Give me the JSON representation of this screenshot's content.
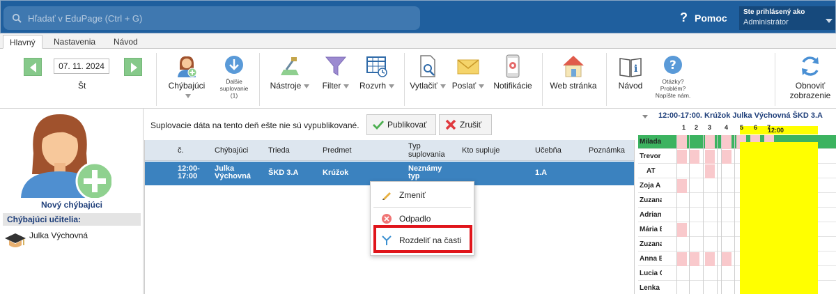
{
  "topbar": {
    "search_placeholder": "Hľadať v EduPage (Ctrl + G)",
    "help_label": "Pomoc",
    "user_line1": "Ste prihlásený ako",
    "user_line2": "Administrátor"
  },
  "tabs": [
    {
      "label": "Hlavný",
      "active": true
    },
    {
      "label": "Nastavenia",
      "active": false
    },
    {
      "label": "Návod",
      "active": false
    }
  ],
  "ribbon": {
    "date": "07. 11. 2024",
    "day": "Št",
    "chybajuci": "Chýbajúci",
    "dalsie_l1": "Ďalšie",
    "dalsie_l2": "suplovanie",
    "dalsie_l3": "(1)",
    "nastroje": "Nástroje",
    "filter": "Filter",
    "rozvrh": "Rozvrh",
    "vytlacit": "Vytlačiť",
    "poslat": "Poslať",
    "notifikacie": "Notifikácie",
    "web": "Web stránka",
    "navod": "Návod",
    "otazky_l1": "Otázky?",
    "otazky_l2": "Problém?",
    "otazky_l3": "Napíšte nám.",
    "obnovit_l1": "Obnoviť",
    "obnovit_l2": "zobrazenie"
  },
  "left": {
    "new_absent": "Nový chýbajúci",
    "absent_teachers_header": "Chýbajúci učitelia:",
    "absent_teachers": [
      "Julka Výchovná"
    ]
  },
  "main": {
    "message": "Suplovacie dáta na tento deň ešte nie sú vypublikované.",
    "publish": "Publikovať",
    "cancel": "Zrušiť",
    "columns": {
      "c": "č.",
      "chybajuci": "Chýbajúci",
      "trieda": "Trieda",
      "predmet": "Predmet",
      "typ_l1": "Typ",
      "typ_l2": "suplovania",
      "kto": "Kto supluje",
      "ucebna": "Učebňa",
      "poznamka": "Poznámka"
    },
    "row": {
      "time_l1": "12:00-",
      "time_l2": "17:00",
      "absent_l1": "Julka",
      "absent_l2": "Výchovná",
      "trieda": "ŠKD 3.A",
      "predmet": "Krúžok",
      "typ_l1": "Neznámy",
      "typ_l2": "typ",
      "ucebna": "1.A"
    }
  },
  "context_menu": {
    "zmenit": "Zmeniť",
    "odpadlo": "Odpadlo",
    "rozdelit": "Rozdeliť na časti"
  },
  "right": {
    "title": "12:00-17:00. Krúžok Julka Výchovná ŠKD 3.A",
    "periods": [
      "1",
      "2",
      "3",
      "4",
      "5",
      "6",
      "7"
    ],
    "time_label": "12:00",
    "teachers": [
      "Milada",
      "Trevor",
      "AT",
      "Zoja A",
      "Zuzana",
      "Adrian",
      "Mária E",
      "Zuzana",
      "Anna B",
      "Lucia C",
      "Lenka"
    ]
  },
  "colors": {
    "topbar": "#1f5f9e",
    "selected_row": "#3b82bf",
    "highlight": "#e0151b",
    "pink": "#f9c9cc",
    "yellow": "#ffff00",
    "green": "#3cb360"
  }
}
